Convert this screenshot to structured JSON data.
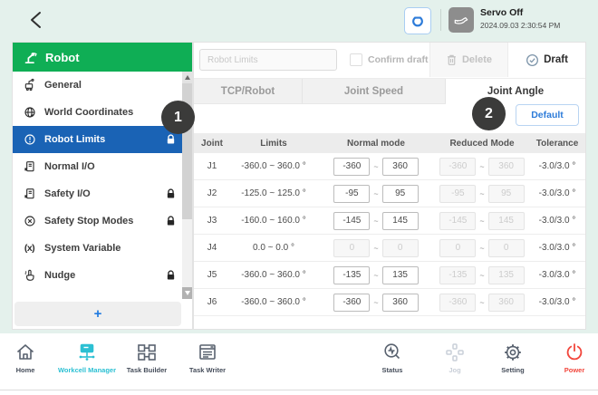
{
  "colors": {
    "background_mint": "#e4f1ec",
    "sidebar_green": "#0fae55",
    "selected_blue": "#1a63b5",
    "accent_blue": "#2e7cd9",
    "active_cyan": "#2cc0d3",
    "power_red": "#f2473d",
    "badge_dark": "#3b3b3a"
  },
  "topbar": {
    "servo_status": "Servo Off",
    "timestamp": "2024.09.03 2:30:54 PM"
  },
  "sidebar": {
    "title": "Robot",
    "items": [
      {
        "label": "General",
        "locked": false,
        "selected": false
      },
      {
        "label": "World Coordinates",
        "locked": true,
        "selected": false
      },
      {
        "label": "Robot Limits",
        "locked": true,
        "selected": true
      },
      {
        "label": "Normal I/O",
        "locked": false,
        "selected": false
      },
      {
        "label": "Safety I/O",
        "locked": true,
        "selected": false
      },
      {
        "label": "Safety Stop Modes",
        "locked": true,
        "selected": false
      },
      {
        "label": "System Variable",
        "locked": false,
        "selected": false,
        "icon_text": "(x)"
      },
      {
        "label": "Nudge",
        "locked": true,
        "selected": false
      }
    ],
    "add_label": "+"
  },
  "toolbar": {
    "name_placeholder": "Robot Limits",
    "confirm_draft": "Confirm draft",
    "delete": "Delete",
    "draft": "Draft"
  },
  "tabs": [
    {
      "label": "TCP/Robot",
      "active": false
    },
    {
      "label": "Joint Speed",
      "active": false
    },
    {
      "label": "Joint Angle",
      "active": true
    }
  ],
  "content": {
    "default_button": "Default",
    "annotations": [
      "1",
      "2"
    ]
  },
  "table": {
    "columns": [
      "Joint",
      "Limits",
      "Normal mode",
      "Reduced Mode",
      "Tolerance"
    ],
    "range_separator": "~",
    "rows": [
      {
        "joint": "J1",
        "limits": "-360.0 ~ 360.0 °",
        "normal_min": "-360",
        "normal_max": "360",
        "reduced_min": "-360",
        "reduced_max": "360",
        "tolerance": "-3.0/3.0 °",
        "normal_enabled": true
      },
      {
        "joint": "J2",
        "limits": "-125.0 ~ 125.0 °",
        "normal_min": "-95",
        "normal_max": "95",
        "reduced_min": "-95",
        "reduced_max": "95",
        "tolerance": "-3.0/3.0 °",
        "normal_enabled": true
      },
      {
        "joint": "J3",
        "limits": "-160.0 ~ 160.0 °",
        "normal_min": "-145",
        "normal_max": "145",
        "reduced_min": "-145",
        "reduced_max": "145",
        "tolerance": "-3.0/3.0 °",
        "normal_enabled": true
      },
      {
        "joint": "J4",
        "limits": "0.0 ~ 0.0 °",
        "normal_min": "0",
        "normal_max": "0",
        "reduced_min": "0",
        "reduced_max": "0",
        "tolerance": "-3.0/3.0 °",
        "normal_enabled": false
      },
      {
        "joint": "J5",
        "limits": "-360.0 ~ 360.0 °",
        "normal_min": "-135",
        "normal_max": "135",
        "reduced_min": "-135",
        "reduced_max": "135",
        "tolerance": "-3.0/3.0 °",
        "normal_enabled": true
      },
      {
        "joint": "J6",
        "limits": "-360.0 ~ 360.0 °",
        "normal_min": "-360",
        "normal_max": "360",
        "reduced_min": "-360",
        "reduced_max": "360",
        "tolerance": "-3.0/3.0 °",
        "normal_enabled": true
      }
    ]
  },
  "bottom_nav": {
    "items": [
      {
        "label": "Home",
        "state": "normal"
      },
      {
        "label": "Workcell Manager",
        "state": "active"
      },
      {
        "label": "Task Builder",
        "state": "normal"
      },
      {
        "label": "Task Writer",
        "state": "normal"
      },
      {
        "label": "Status",
        "state": "normal"
      },
      {
        "label": "Jog",
        "state": "disabled"
      },
      {
        "label": "Setting",
        "state": "normal"
      },
      {
        "label": "Power",
        "state": "power"
      }
    ]
  }
}
